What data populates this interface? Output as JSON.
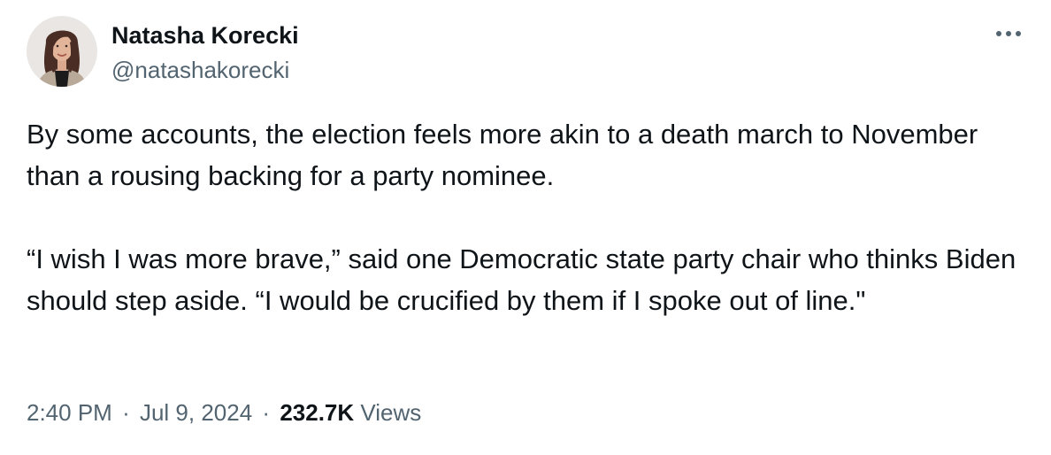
{
  "author": {
    "display_name": "Natasha Korecki",
    "handle": "@natashakorecki"
  },
  "tweet": {
    "paragraph_1": "By some accounts, the election feels more akin to a death march to November than a rousing backing for a party nominee.",
    "paragraph_2": "“I wish I was more brave,” said one Democratic state party chair who thinks Biden should step aside. “I would be crucified by them if I spoke out of line.\"",
    "time": "2:40 PM",
    "date": "Jul 9, 2024",
    "separator": "·",
    "views_count": "232.7K",
    "views_label": "Views"
  },
  "icons": {
    "more": "more-horizontal-icon",
    "avatar": "profile-photo"
  },
  "colors": {
    "primary_text": "#0f1419",
    "secondary_text": "#536471",
    "background": "#ffffff"
  }
}
